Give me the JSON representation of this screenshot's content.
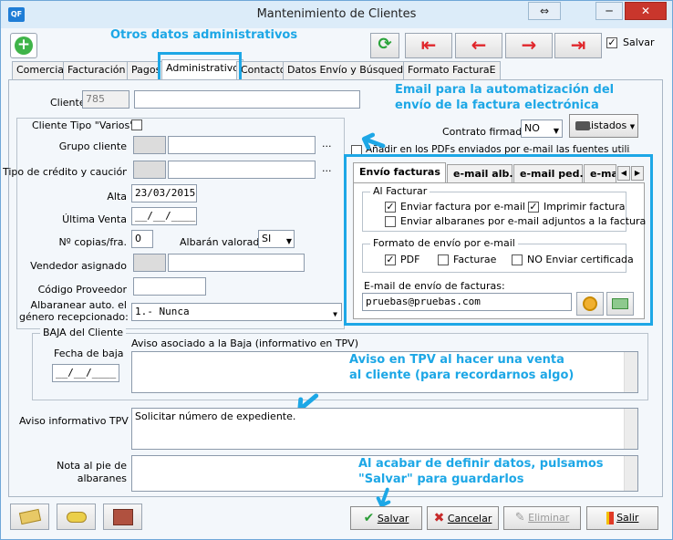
{
  "window": {
    "title": "Mantenimiento de Clientes",
    "app_badge": "QF",
    "restore_glyph": "⇔",
    "minimize_glyph": "─",
    "close_glyph": "✕"
  },
  "toolbar": {
    "add": "+",
    "refresh": "⟳",
    "first": "⇤",
    "prev": "←",
    "next": "→",
    "last": "⇥",
    "save_checkbox_label": "Salvar",
    "save_checked": "✓"
  },
  "annotations": {
    "otros_datos": "Otros datos administrativos",
    "email_auto": "Email para la automatización del envío de la factura electrónica",
    "aviso_tpv": "Aviso en TPV al hacer una venta al cliente (para recordarnos algo)",
    "salvar": "Al acabar de definir datos, pulsamos \"Salvar\" para guardarlos"
  },
  "tabs": [
    {
      "label": "Comercial"
    },
    {
      "label": "Facturación"
    },
    {
      "label": "Pagos"
    },
    {
      "label": "Administrativo"
    },
    {
      "label": "Contacto"
    },
    {
      "label": "Datos Envío y Búsqueda"
    },
    {
      "label": "Formato FacturaE"
    }
  ],
  "form": {
    "cliente_label": "Cliente",
    "cliente_code": "785",
    "cliente_name": "",
    "tipo_varios_label": "Cliente Tipo \"Varios\"",
    "grupo_label": "Grupo cliente",
    "grupo_code": "",
    "grupo_name": "",
    "dots": "...",
    "credito_label": "Tipo de crédito y caución",
    "credito_code": "",
    "credito_name": "",
    "alta_label": "Alta",
    "alta_value": "23/03/2015",
    "ultima_label": "Última Venta",
    "ultima_value": "__/__/____",
    "copias_label": "Nº copias/fra.",
    "copias_value": "0",
    "albaran_label": "Albarán valorado",
    "albaran_value": "SI",
    "vendedor_label": "Vendedor asignado",
    "vendedor_code": "",
    "vendedor_name": "",
    "proveedor_label": "Código Proveedor",
    "proveedor_value": "",
    "albaranear_label1": "Albaranear auto. el",
    "albaranear_label2": "género recepcionado:",
    "albaranear_value": "1.- Nunca",
    "contrato_label": "Contrato firmado",
    "contrato_value": "NO",
    "listados_label": "Listados",
    "anadir_label": "Añadir en los PDFs enviados por e-mail las fuentes utilizadas"
  },
  "email_tabs": [
    {
      "label": "Envío facturas"
    },
    {
      "label": "e-mail alb."
    },
    {
      "label": "e-mail ped."
    },
    {
      "label": "e-mail"
    }
  ],
  "email": {
    "al_facturar_title": "Al Facturar",
    "enviar_factura": "Enviar factura por e-mail",
    "enviar_factura_checked": "✓",
    "imprimir_factura": "Imprimir factura",
    "imprimir_checked": "✓",
    "enviar_albaranes": "Enviar albaranes por e-mail adjuntos a la factura",
    "formato_title": "Formato de envío por e-mail",
    "pdf_label": "PDF",
    "pdf_checked": "✓",
    "facturae_label": "Facturae",
    "no_cert_label": "NO Enviar certificada",
    "email_label": "E-mail de envío de facturas:",
    "email_value": "pruebas@pruebas.com"
  },
  "baja": {
    "title": "BAJA del Cliente",
    "fecha_label": "Fecha de baja",
    "fecha_value": "__/__/____",
    "aviso_label": "Aviso asociado a la Baja (informativo en TPV)",
    "aviso_value": ""
  },
  "tpv": {
    "label": "Aviso informativo TPV",
    "value": "Solicitar número de expediente."
  },
  "nota": {
    "label1": "Nota al pie de",
    "label2": "albaranes",
    "value": ""
  },
  "footer": {
    "salvar": "Salvar",
    "cancelar": "Cancelar",
    "eliminar": "Eliminar",
    "salir": "Salir",
    "salvar_mark": "✔",
    "cancelar_mark": "✖"
  },
  "colors": {
    "annotation": "#1da7e6",
    "title_bar": "#dcecf9",
    "close": "#c9362c",
    "nav_red": "#e0262b"
  }
}
